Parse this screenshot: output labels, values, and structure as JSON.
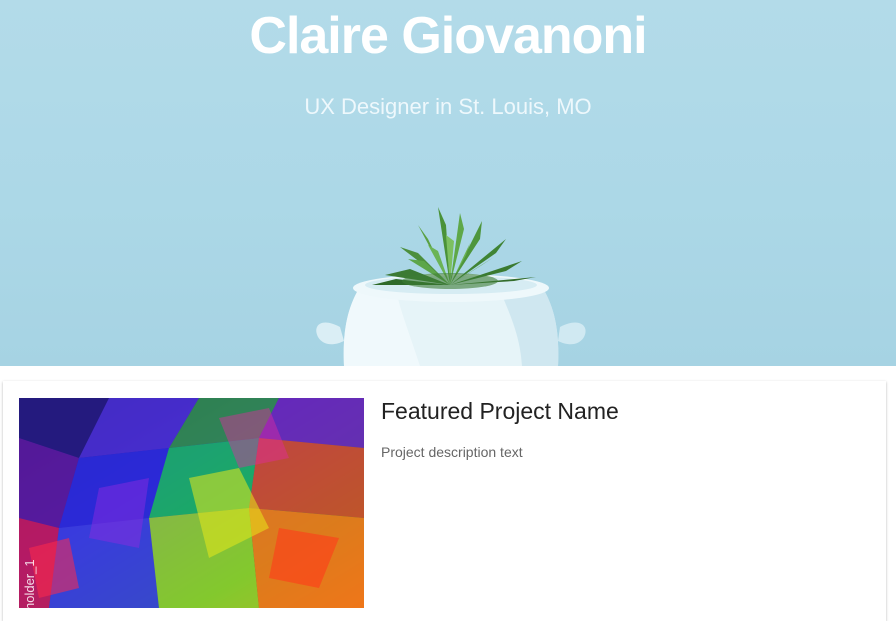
{
  "hero": {
    "title": "Claire Giovanoni",
    "subtitle": "UX Designer in St. Louis, MO",
    "background_color": "#acd8e7",
    "image": "succulent-in-white-pot"
  },
  "featured_project": {
    "name": "Featured Project Name",
    "description": "Project description text",
    "image_caption": "holder_1",
    "image": "colorful-abstract-polygons"
  },
  "colors": {
    "title_text": "#ffffff",
    "card_background": "#ffffff",
    "project_name_text": "#222222",
    "project_desc_text": "#666666"
  }
}
